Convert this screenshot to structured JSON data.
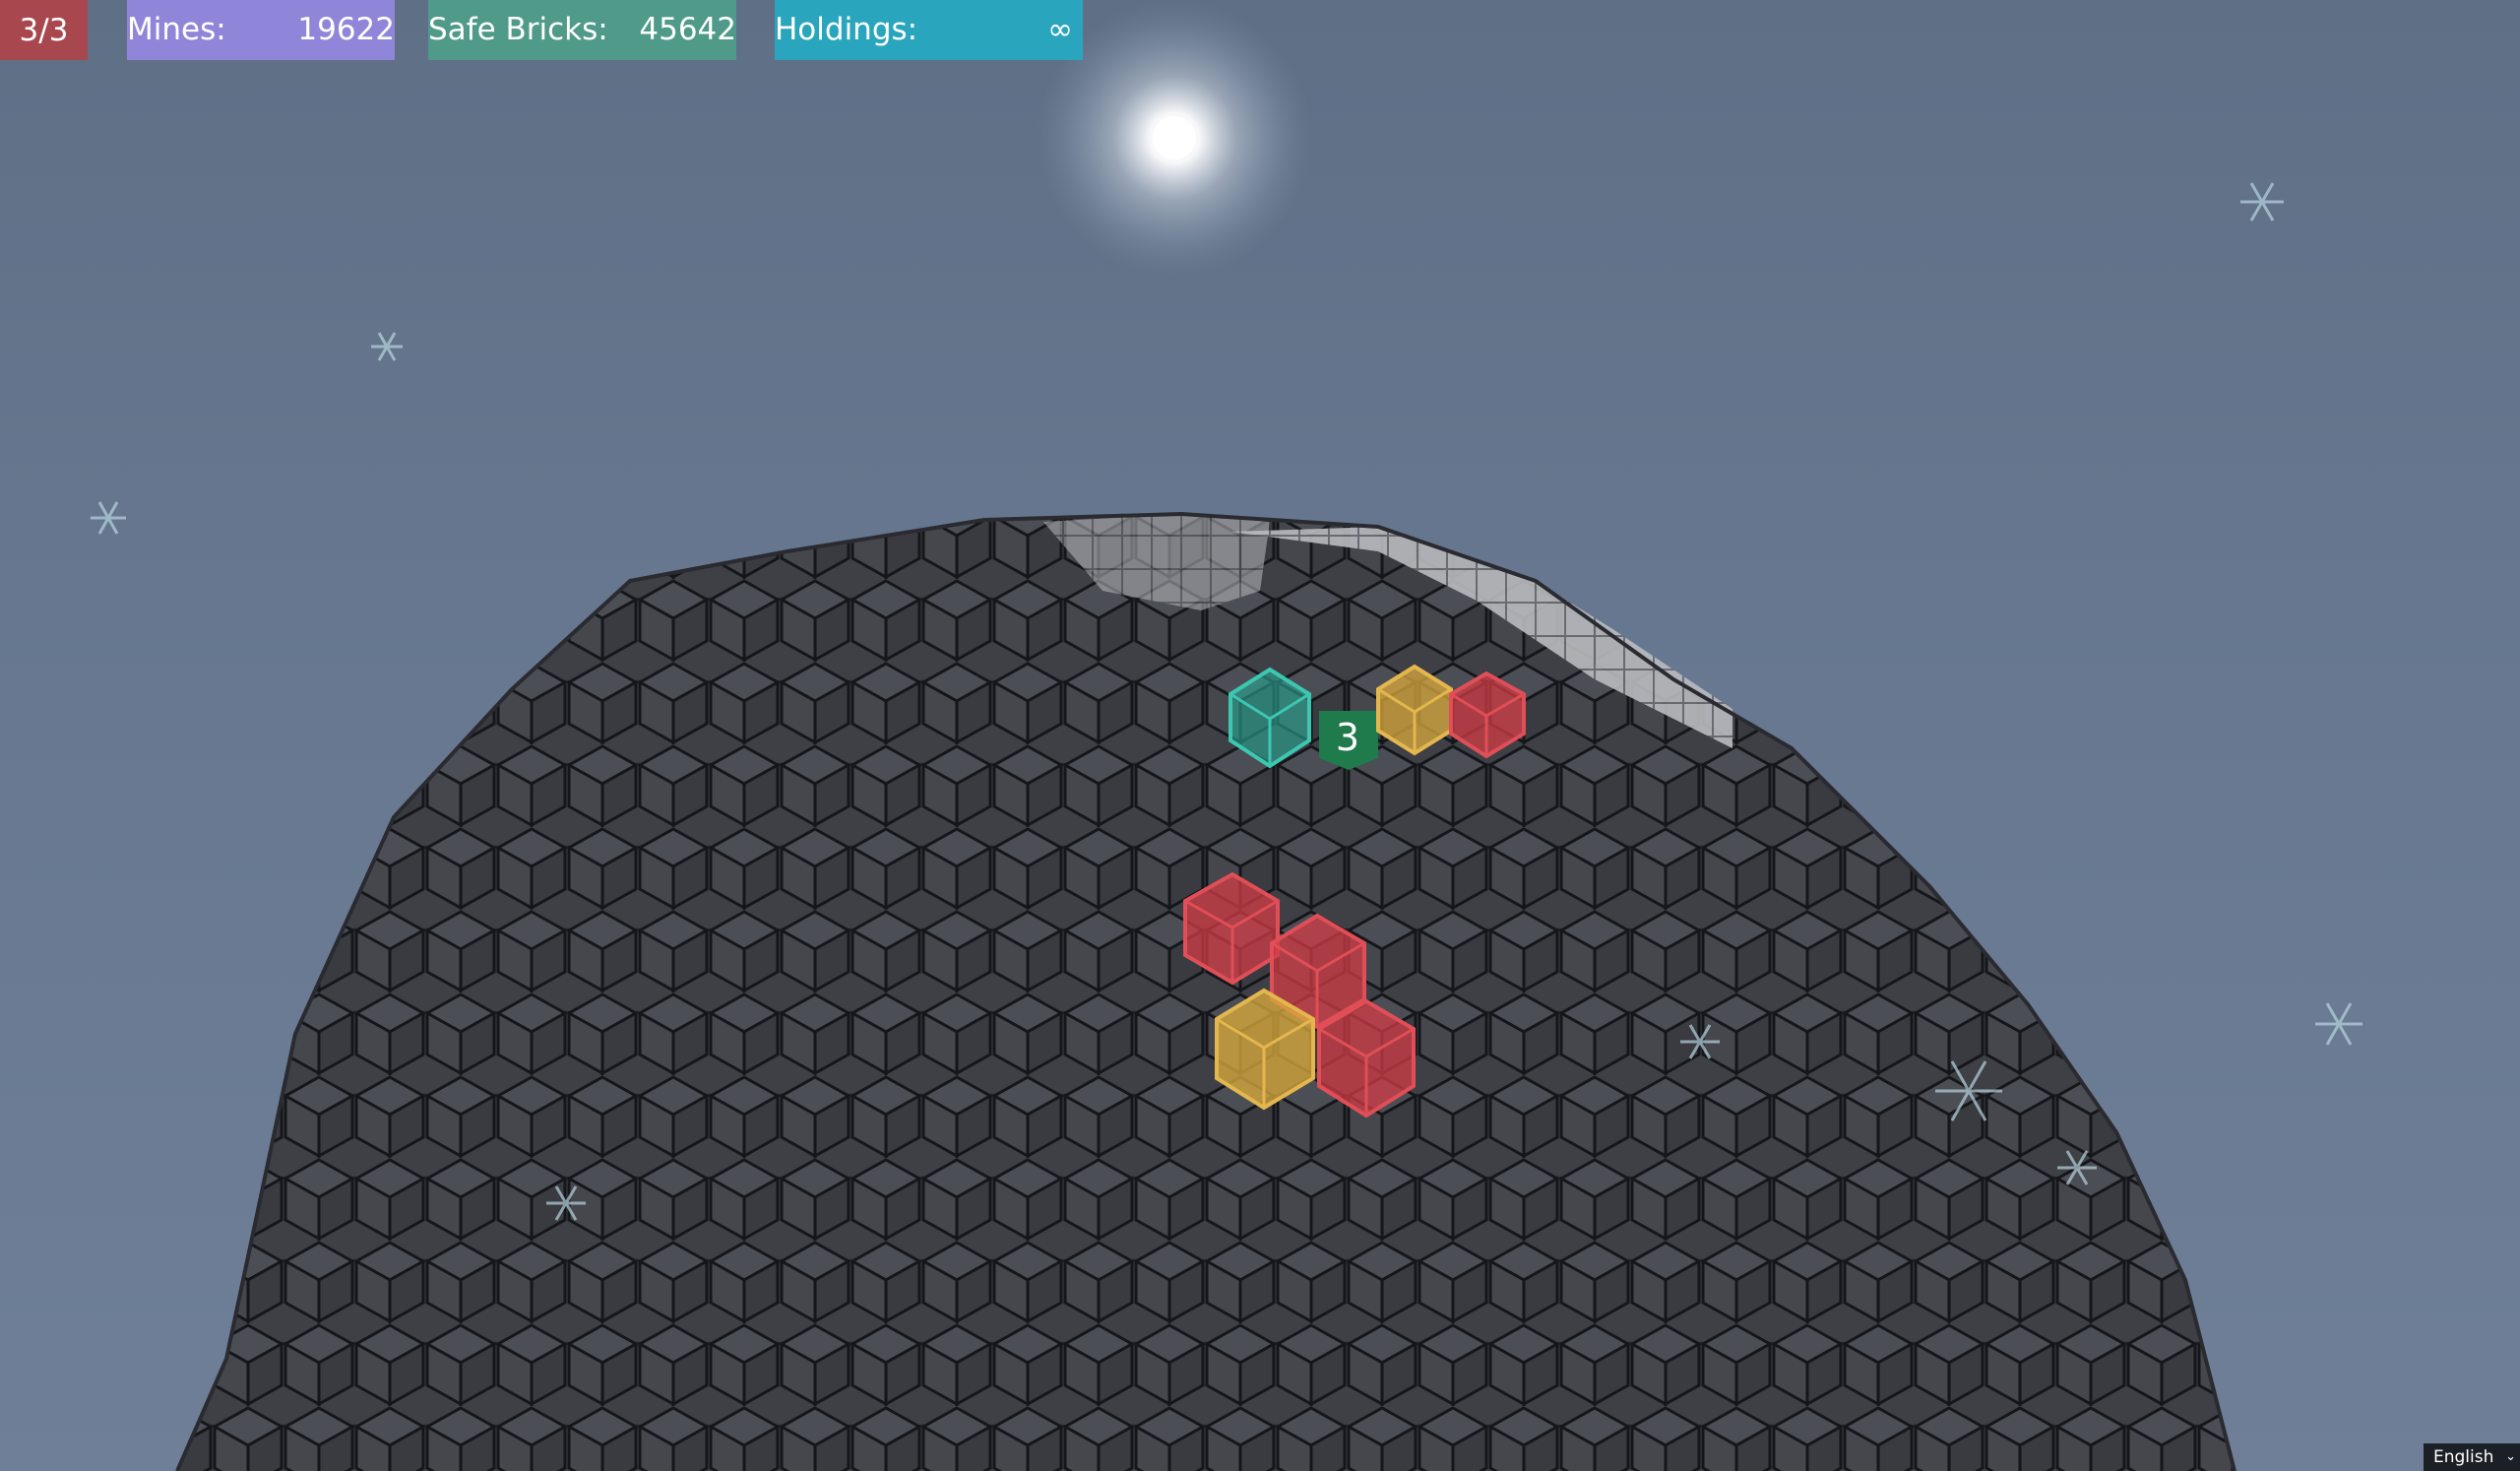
{
  "hud": {
    "lives": "3/3",
    "mines_label": "Mines:",
    "mines_value": "19622",
    "safe_label": "Safe Bricks:",
    "safe_value": "45642",
    "holdings_label": "Holdings:",
    "holdings_value": "∞"
  },
  "revealed_number": "3",
  "language": {
    "selected": "English",
    "icon": "chevron-down-icon"
  },
  "colors": {
    "lives_bg": "#a8474d",
    "mines_bg": "#8f86d9",
    "safe_bg": "#4f9a88",
    "holdings_bg": "#29a5bd",
    "flag_red": "#d23c46",
    "flag_yellow": "#d9a93c",
    "selected_teal": "#2aa894",
    "number_tile": "#1f7a4c",
    "brick_dark": "#3a3c41",
    "brick_light": "#c8c9cc"
  },
  "icons": [
    "sun-icon",
    "snowflake-icon"
  ]
}
